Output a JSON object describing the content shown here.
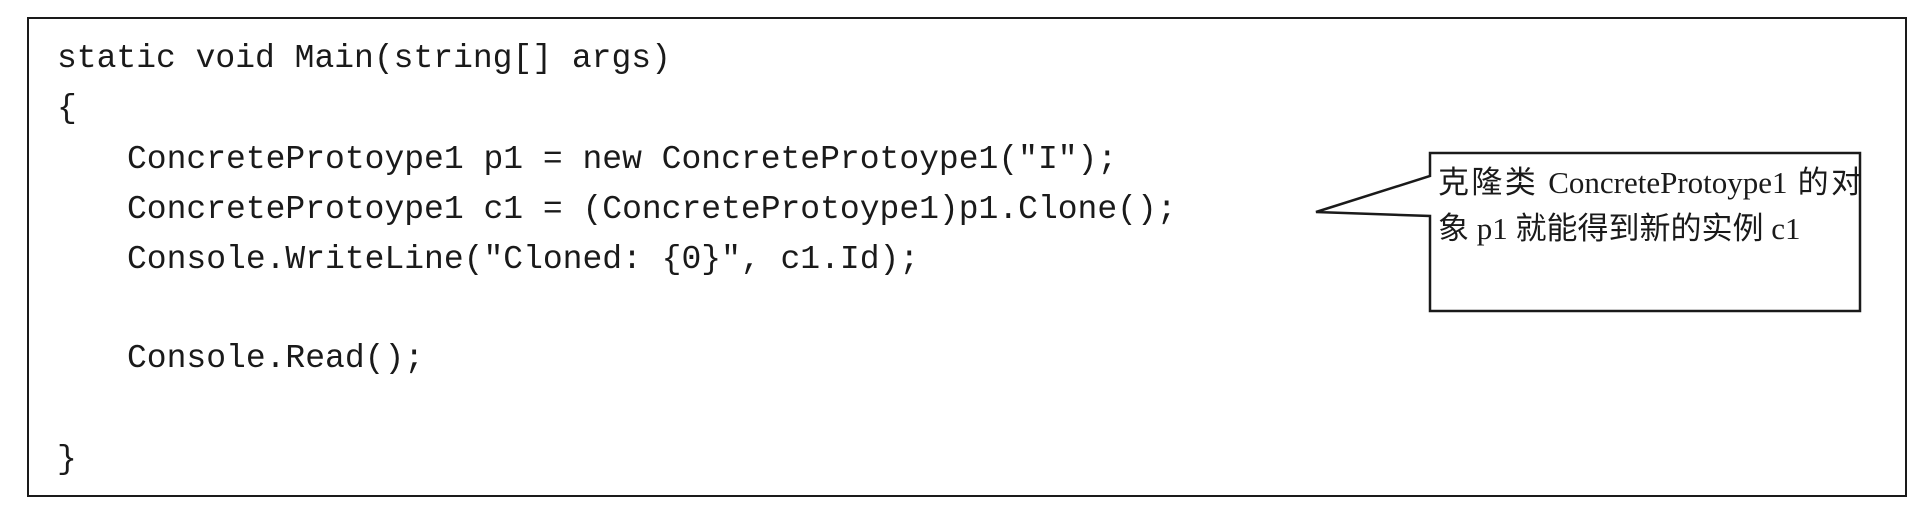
{
  "code": {
    "lines": [
      "static void Main(string[] args)",
      "{",
      "ConcreteProtoype1 p1 = new ConcreteProtoype1(\"I\");",
      "ConcreteProtoype1 c1 = (ConcreteProtoype1)p1.Clone();",
      "Console.WriteLine(\"Cloned: {0}\", c1.Id);",
      "Console.Read();",
      "}"
    ]
  },
  "callout": {
    "text": "克隆类 ConcreteProtoype1 的对象 p1 就能得到新的实例 c1"
  }
}
